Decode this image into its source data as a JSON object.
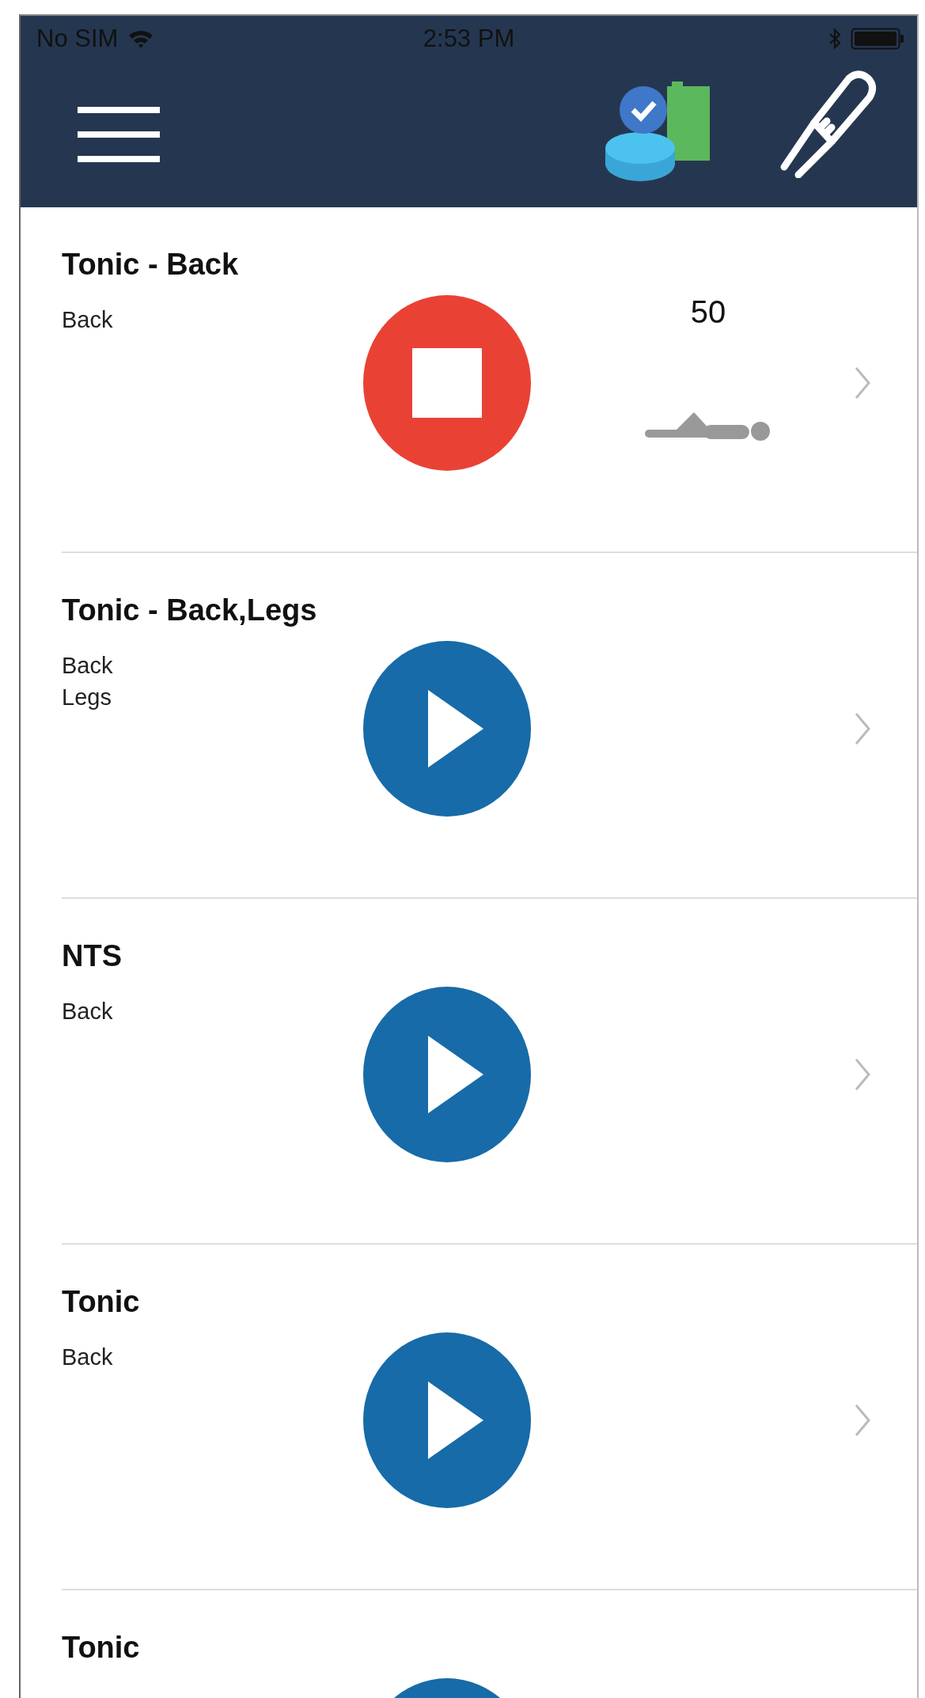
{
  "status_bar": {
    "carrier": "No SIM",
    "time": "2:53 PM"
  },
  "programs": [
    {
      "title": "Tonic - Back",
      "areas": [
        "Back"
      ],
      "running": true,
      "amplitude": "50"
    },
    {
      "title": "Tonic - Back,Legs",
      "areas": [
        "Back",
        "Legs"
      ],
      "running": false
    },
    {
      "title": "NTS",
      "areas": [
        "Back"
      ],
      "running": false
    },
    {
      "title": "Tonic",
      "areas": [
        "Back"
      ],
      "running": false
    },
    {
      "title": "Tonic",
      "running": false
    }
  ]
}
